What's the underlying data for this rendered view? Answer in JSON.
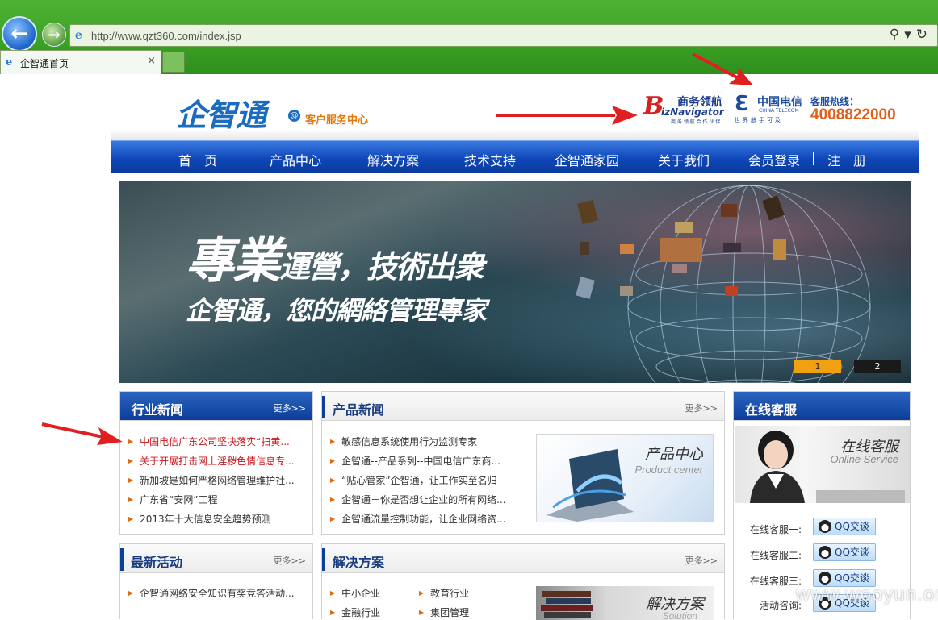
{
  "browser": {
    "url": "http://www.qzt360.com/index.jsp",
    "tab_title": "企智通首页",
    "tab_close": "×"
  },
  "header": {
    "logo_text": "企智通",
    "logo_subtitle": "客户服务中心",
    "biz_cn": "商务领航",
    "biz_en": "izNavigator",
    "biz_b": "B",
    "biz_small": "商 务 领 航 合 作 伙 伴",
    "ct_name": "中国电信",
    "ct_en": "CHINA TELECOM",
    "ct_slogan": "世界触手可及",
    "hotline_label": "客服热线：",
    "hotline_number": "4008822000"
  },
  "nav": {
    "items": [
      "首　页",
      "产品中心",
      "解决方案",
      "技术支持",
      "企智通家园",
      "关于我们",
      "会员登录",
      "|",
      "注　册"
    ]
  },
  "banner": {
    "line1_a": "專業",
    "line1_b": "運營，技術出衆",
    "line2": "企智通，您的網絡管理專家",
    "page1": "1",
    "page2": "2"
  },
  "industry_news": {
    "title": "行业新闻",
    "more": "更多>>",
    "items": [
      "中国电信广东公司坚决落实“扫黄...",
      "关于开展打击网上淫秽色情信息专...",
      "新加坡是如何严格网络管理维护社...",
      "广东省“安网”工程",
      "2013年十大信息安全趋势预测"
    ]
  },
  "product_news": {
    "title": "产品新闻",
    "more": "更多>>",
    "items": [
      "敏感信息系统使用行为监测专家",
      "企智通--产品系列--中国电信广东商...",
      "“贴心管家”企智通，让工作实至名归",
      "企智通－你是否想让企业的所有网络...",
      "企智通流量控制功能，让企业网络资..."
    ],
    "thumb_cn": "产品中心",
    "thumb_en": "Product center"
  },
  "online_service": {
    "title": "在线客服",
    "image_cn": "在线客服",
    "image_en": "Online Service",
    "rows": [
      {
        "label": "在线客服一:",
        "button": "QQ交谈"
      },
      {
        "label": "在线客服二:",
        "button": "QQ交谈"
      },
      {
        "label": "在线客服三:",
        "button": "QQ交谈"
      },
      {
        "label": "活动咨询:",
        "button": "QQ交谈"
      }
    ]
  },
  "latest_activity": {
    "title": "最新活动",
    "more": "更多>>",
    "items": [
      "企智通网络安全知识有奖竞答活动..."
    ]
  },
  "solutions": {
    "title": "解决方案",
    "more": "更多>>",
    "col1": [
      "中小企业",
      "金融行业"
    ],
    "col2": [
      "教育行业",
      "集团管理"
    ],
    "thumb_cn": "解决方案",
    "thumb_en": "Solution"
  },
  "watermark": "www.wooyun.org",
  "colors": {
    "nav_blue": "#0f47b8",
    "accent_orange": "#e07a10",
    "news_red": "#c4161c",
    "arrow_red": "#e02020"
  }
}
